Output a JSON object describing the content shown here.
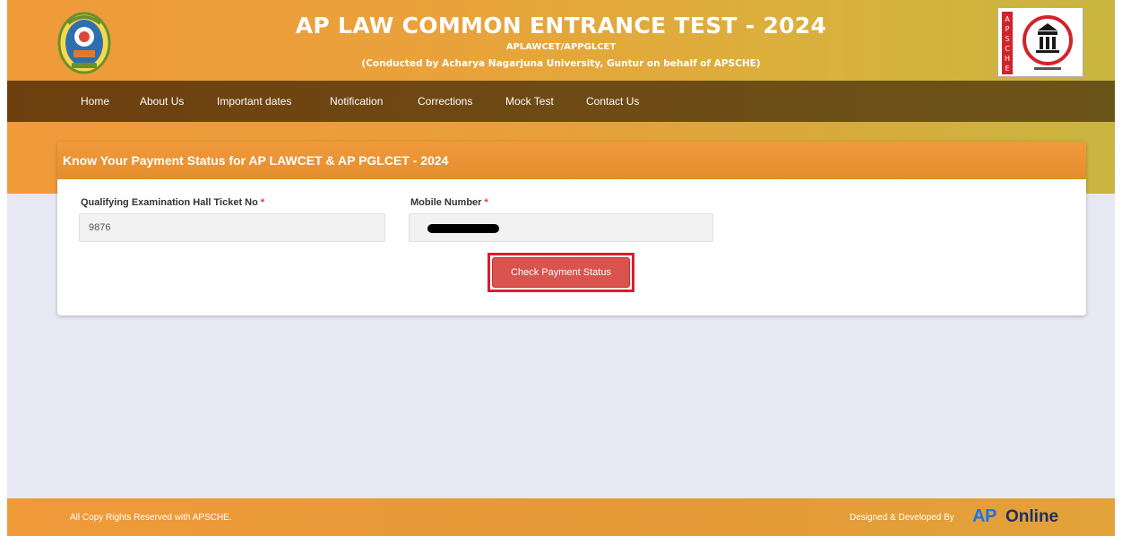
{
  "header": {
    "title": "AP LAW COMMON ENTRANCE TEST - 2024",
    "subtitle": "APLAWCET/APPGLCET",
    "conducted_by": "(Conducted by Acharya Nagarjuna University, Guntur on behalf of APSCHE)",
    "left_logo": "university-emblem",
    "right_logo": "apsche-logo",
    "right_logo_letters": "APSCHE"
  },
  "nav": {
    "items": [
      "Home",
      "About Us",
      "Important dates",
      "Notification",
      "Corrections",
      "Mock Test",
      "Contact Us"
    ]
  },
  "card": {
    "title": "Know Your Payment Status for AP LAWCET & AP PGLCET - 2024",
    "hall_ticket": {
      "label": "Qualifying Examination Hall Ticket No",
      "value": "9876"
    },
    "mobile": {
      "label": "Mobile Number",
      "value": "",
      "redacted": true
    },
    "required_mark": "*",
    "button_label": "Check Payment Status"
  },
  "footer": {
    "copyright": "All Copy Rights Reserved with APSCHE.",
    "designed_by": "Designed & Developed By",
    "brand_ap": "AP",
    "brand_online": "Online"
  },
  "colors": {
    "header_orange": "#f09a3a",
    "nav_brown": "#6d3f0e",
    "button_red": "#d9534f",
    "highlight_red": "#e01a2a",
    "brand_blue": "#1a73e8"
  }
}
